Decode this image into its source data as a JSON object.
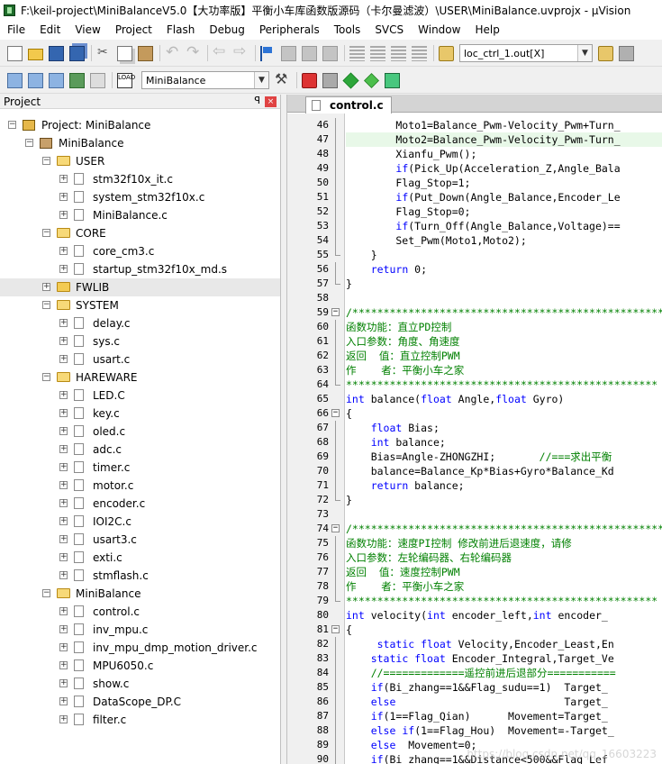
{
  "window": {
    "title": "F:\\keil-project\\MiniBalanceV5.0【大功率版】平衡小车库函数版源码（卡尔曼滤波）\\USER\\MiniBalance.uvprojx - µVision"
  },
  "menu": [
    "File",
    "Edit",
    "View",
    "Project",
    "Flash",
    "Debug",
    "Peripherals",
    "Tools",
    "SVCS",
    "Window",
    "Help"
  ],
  "toolbar1": {
    "find_combo_value": "loc_ctrl_1.out[X]"
  },
  "toolbar2": {
    "target_combo_value": "MiniBalance",
    "load_label": "LOAD"
  },
  "project_panel": {
    "title": "Project",
    "pin": "ꟼ",
    "close": "×",
    "tree": [
      {
        "label": "Project: MiniBalance",
        "type": "project",
        "level": 0
      },
      {
        "label": "MiniBalance",
        "type": "target",
        "level": 1
      },
      {
        "label": "USER",
        "type": "folder",
        "level": 2,
        "open": true
      },
      {
        "label": "stm32f10x_it.c",
        "type": "file",
        "level": 3
      },
      {
        "label": "system_stm32f10x.c",
        "type": "file",
        "level": 3
      },
      {
        "label": "MiniBalance.c",
        "type": "file",
        "level": 3,
        "leaf": true
      },
      {
        "label": "CORE",
        "type": "folder",
        "level": 2,
        "open": true
      },
      {
        "label": "core_cm3.c",
        "type": "file",
        "level": 3
      },
      {
        "label": "startup_stm32f10x_md.s",
        "type": "file",
        "level": 3,
        "leaf": true
      },
      {
        "label": "FWLIB",
        "type": "folder",
        "level": 2,
        "open": false,
        "selected": true
      },
      {
        "label": "SYSTEM",
        "type": "folder",
        "level": 2,
        "open": true
      },
      {
        "label": "delay.c",
        "type": "file",
        "level": 3
      },
      {
        "label": "sys.c",
        "type": "file",
        "level": 3
      },
      {
        "label": "usart.c",
        "type": "file",
        "level": 3
      },
      {
        "label": "HAREWARE",
        "type": "folder",
        "level": 2,
        "open": true
      },
      {
        "label": "LED.C",
        "type": "file",
        "level": 3
      },
      {
        "label": "key.c",
        "type": "file",
        "level": 3
      },
      {
        "label": "oled.c",
        "type": "file",
        "level": 3
      },
      {
        "label": "adc.c",
        "type": "file",
        "level": 3
      },
      {
        "label": "timer.c",
        "type": "file",
        "level": 3
      },
      {
        "label": "motor.c",
        "type": "file",
        "level": 3
      },
      {
        "label": "encoder.c",
        "type": "file",
        "level": 3
      },
      {
        "label": "IOI2C.c",
        "type": "file",
        "level": 3
      },
      {
        "label": "usart3.c",
        "type": "file",
        "level": 3
      },
      {
        "label": "exti.c",
        "type": "file",
        "level": 3
      },
      {
        "label": "stmflash.c",
        "type": "file",
        "level": 3
      },
      {
        "label": "MiniBalance",
        "type": "folder",
        "level": 2,
        "open": true
      },
      {
        "label": "control.c",
        "type": "file",
        "level": 3
      },
      {
        "label": "inv_mpu.c",
        "type": "file",
        "level": 3
      },
      {
        "label": "inv_mpu_dmp_motion_driver.c",
        "type": "file",
        "level": 3
      },
      {
        "label": "MPU6050.c",
        "type": "file",
        "level": 3
      },
      {
        "label": "show.c",
        "type": "file",
        "level": 3
      },
      {
        "label": "DataScope_DP.C",
        "type": "file",
        "level": 3
      },
      {
        "label": "filter.c",
        "type": "file",
        "level": 3
      }
    ]
  },
  "editor": {
    "active_tab": "control.c",
    "watermark": "https://blog.csdn.net/qq_16603223",
    "lines": [
      {
        "n": "46",
        "text": "        Moto1=Balance_Pwm-Velocity_Pwm+Turn_",
        "fold": "line"
      },
      {
        "n": "47",
        "text": "        Moto2=Balance_Pwm-Velocity_Pwm-Turn_",
        "fold": "line",
        "hl": true
      },
      {
        "n": "48",
        "text": "        Xianfu_Pwm();",
        "fold": "line"
      },
      {
        "n": "49",
        "text": "        if(Pick_Up(Acceleration_Z,Angle_Bala",
        "fold": "line"
      },
      {
        "n": "50",
        "text": "        Flag_Stop=1;",
        "fold": "line"
      },
      {
        "n": "51",
        "text": "        if(Put_Down(Angle_Balance,Encoder_Le",
        "fold": "line"
      },
      {
        "n": "52",
        "text": "        Flag_Stop=0;",
        "fold": "line"
      },
      {
        "n": "53",
        "text": "        if(Turn_Off(Angle_Balance,Voltage)==",
        "fold": "line"
      },
      {
        "n": "54",
        "text": "        Set_Pwm(Moto1,Moto2);",
        "fold": "line"
      },
      {
        "n": "55",
        "text": "    }",
        "fold": "end"
      },
      {
        "n": "56",
        "text": "    return 0;",
        "fold": "line"
      },
      {
        "n": "57",
        "text": "}",
        "fold": "end"
      },
      {
        "n": "58",
        "text": "",
        "fold": ""
      },
      {
        "n": "59",
        "text": "/**************************************************",
        "fold": "box",
        "cm": true
      },
      {
        "n": "60",
        "text": "函数功能：直立PD控制",
        "fold": "line",
        "cm": true
      },
      {
        "n": "61",
        "text": "入口参数：角度、角速度",
        "fold": "line",
        "cm": true
      },
      {
        "n": "62",
        "text": "返回  值：直立控制PWM",
        "fold": "line",
        "cm": true
      },
      {
        "n": "63",
        "text": "作    者：平衡小车之家",
        "fold": "line",
        "cm": true
      },
      {
        "n": "64",
        "text": "**************************************************",
        "fold": "end",
        "cm": true
      },
      {
        "n": "65",
        "text": "int balance(float Angle,float Gyro)",
        "fold": ""
      },
      {
        "n": "66",
        "text": "{",
        "fold": "box"
      },
      {
        "n": "67",
        "text": "    float Bias;",
        "fold": "line"
      },
      {
        "n": "68",
        "text": "    int balance;",
        "fold": "line"
      },
      {
        "n": "69",
        "text": "    Bias=Angle-ZHONGZHI;       //===求出平衡",
        "fold": "line"
      },
      {
        "n": "70",
        "text": "    balance=Balance_Kp*Bias+Gyro*Balance_Kd",
        "fold": "line"
      },
      {
        "n": "71",
        "text": "    return balance;",
        "fold": "line"
      },
      {
        "n": "72",
        "text": "}",
        "fold": "end"
      },
      {
        "n": "73",
        "text": "",
        "fold": ""
      },
      {
        "n": "74",
        "text": "/**************************************************",
        "fold": "box",
        "cm": true
      },
      {
        "n": "75",
        "text": "函数功能：速度PI控制 修改前进后退速度，请修",
        "fold": "line",
        "cm": true
      },
      {
        "n": "76",
        "text": "入口参数：左轮编码器、右轮编码器",
        "fold": "line",
        "cm": true
      },
      {
        "n": "77",
        "text": "返回  值：速度控制PWM",
        "fold": "line",
        "cm": true
      },
      {
        "n": "78",
        "text": "作    者：平衡小车之家",
        "fold": "line",
        "cm": true
      },
      {
        "n": "79",
        "text": "**************************************************",
        "fold": "end",
        "cm": true
      },
      {
        "n": "80",
        "text": "int velocity(int encoder_left,int encoder_",
        "fold": ""
      },
      {
        "n": "81",
        "text": "{",
        "fold": "box"
      },
      {
        "n": "82",
        "text": "     static float Velocity,Encoder_Least,En",
        "fold": "line"
      },
      {
        "n": "83",
        "text": "    static float Encoder_Integral,Target_Ve",
        "fold": "line"
      },
      {
        "n": "84",
        "text": "    //=============遥控前进后退部分===========",
        "fold": "line"
      },
      {
        "n": "85",
        "text": "    if(Bi_zhang==1&&Flag_sudu==1)  Target_",
        "fold": "line"
      },
      {
        "n": "86",
        "text": "    else                           Target_",
        "fold": "line"
      },
      {
        "n": "87",
        "text": "    if(1==Flag_Qian)      Movement=Target_",
        "fold": "line"
      },
      {
        "n": "88",
        "text": "    else if(1==Flag_Hou)  Movement=-Target_",
        "fold": "line"
      },
      {
        "n": "89",
        "text": "    else  Movement=0;",
        "fold": "line"
      },
      {
        "n": "90",
        "text": "    if(Bi_zhang==1&&Distance<500&&Flag_Lef",
        "fold": "line"
      }
    ]
  }
}
